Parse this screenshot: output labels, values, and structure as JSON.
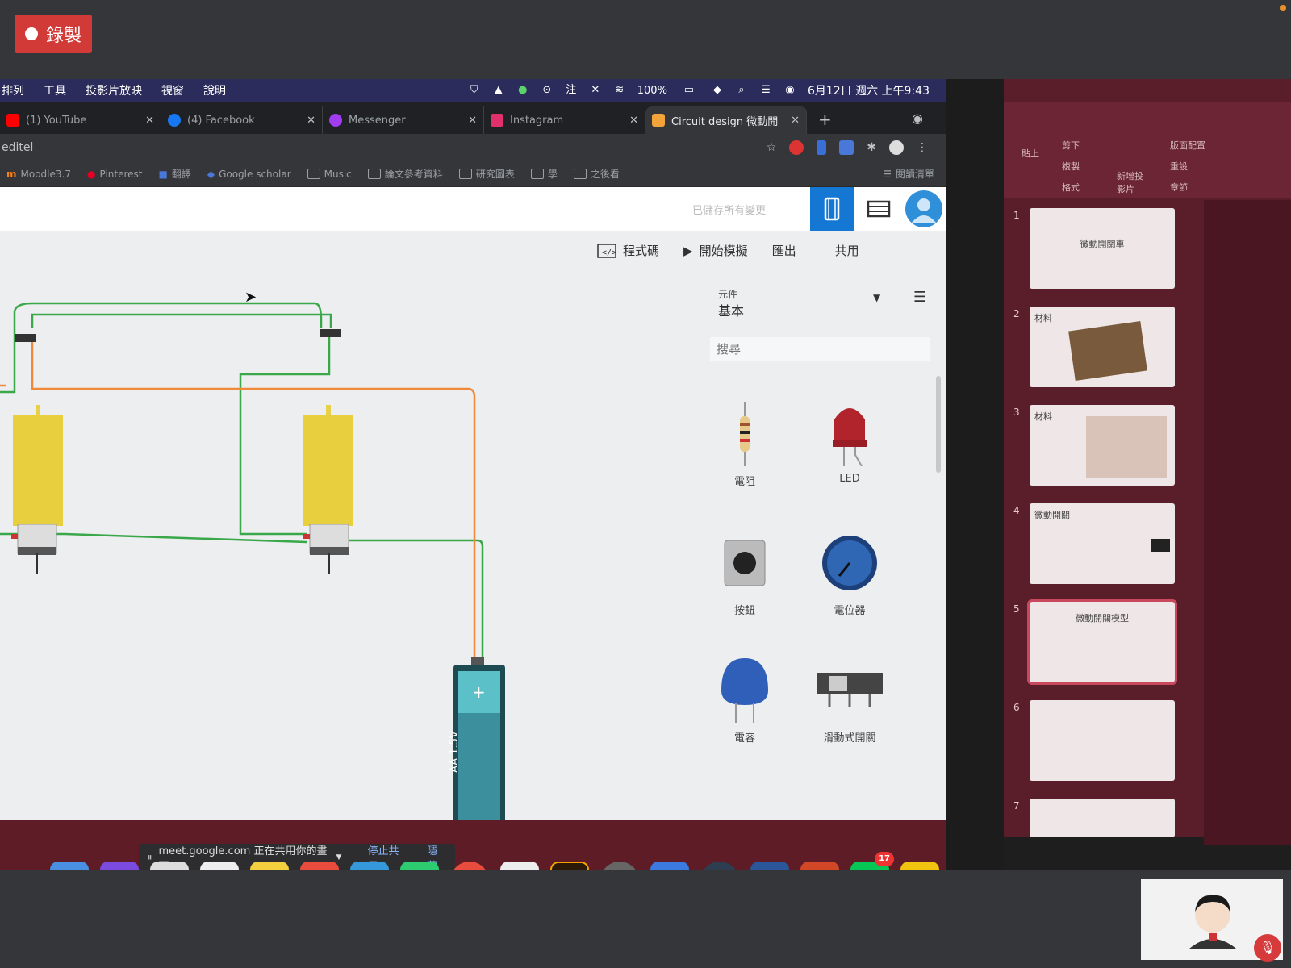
{
  "meet": {
    "record_label": "錄製",
    "share_bar": {
      "text": "meet.google.com 正在共用你的畫面",
      "stop_label": "停止共用",
      "hide_label": "隱藏"
    }
  },
  "mac_menubar": {
    "items": [
      "排列",
      "工具",
      "投影片放映",
      "視窗",
      "說明"
    ],
    "battery": "100%",
    "clock": "6月12日 週六 上午9:43"
  },
  "browser": {
    "tabs": [
      {
        "title": "(1) YouTube",
        "color": "#ff0000"
      },
      {
        "title": "(4) Facebook",
        "color": "#1877f2"
      },
      {
        "title": "Messenger",
        "color": "#a13cf0"
      },
      {
        "title": "Instagram",
        "color": "#e1306c"
      },
      {
        "title": "Circuit design 微動開",
        "color": "#f2a33a"
      }
    ],
    "url": "editel",
    "bookmarks": [
      "Moodle3.7",
      "Pinterest",
      "翻譯",
      "Google scholar",
      "Music",
      "論文參考資料",
      "研究圖表",
      "學",
      "之後看"
    ],
    "bookmarks_right": "閱讀清單"
  },
  "tinkercad": {
    "saved_status": "已儲存所有變更",
    "toolbar": {
      "code": "程式碼",
      "simulate": "開始模擬",
      "export": "匯出",
      "share": "共用"
    },
    "panel": {
      "components_label": "元件",
      "components_value": "基本",
      "search_placeholder": "搜尋",
      "items": [
        "電阻",
        "LED",
        "按鈕",
        "電位器",
        "電容",
        "滑動式開關"
      ]
    },
    "battery_label": "AA 1.5V",
    "battery_plus": "+"
  },
  "powerpoint": {
    "ribbon": {
      "cut": "剪下",
      "copy": "複製",
      "format": "格式",
      "paste": "貼上",
      "new_slide": "新增投影片",
      "layout": "版面配置",
      "reset": "重設",
      "section": "章節"
    },
    "slides": [
      {
        "num": "1",
        "text": "微動開關車"
      },
      {
        "num": "2",
        "text": "材料"
      },
      {
        "num": "3",
        "text": "材料"
      },
      {
        "num": "4",
        "text": "微動開關"
      },
      {
        "num": "5",
        "text": "微動開關模型"
      },
      {
        "num": "6",
        "text": ""
      },
      {
        "num": "7",
        "text": ""
      }
    ]
  },
  "dock": {
    "ai_label": "Ai",
    "en_label": "EN",
    "line_badge": "17"
  }
}
